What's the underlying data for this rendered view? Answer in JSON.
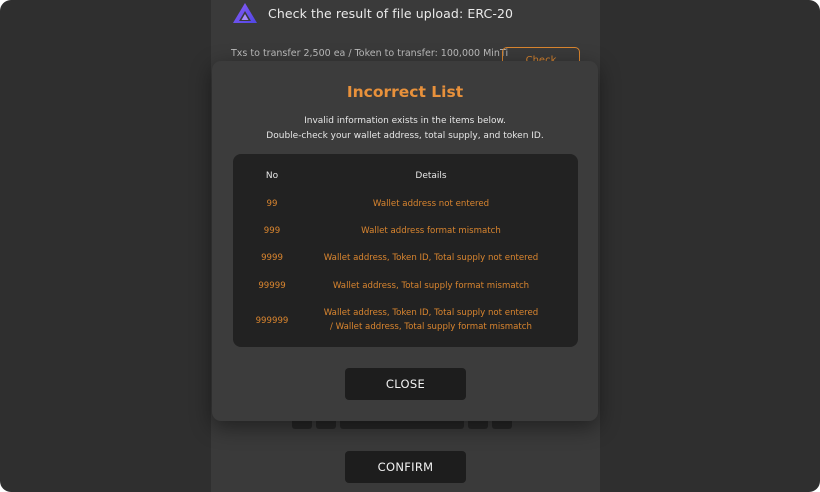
{
  "background": {
    "header_title": "Check the result of file upload: ERC-20",
    "logo_icon": "triangle-logo-icon",
    "tx_info": "Txs to transfer 2,500 ea / Token to transfer: 100,000 MinTi",
    "check_button_label": "Check",
    "confirm_label": "CONFIRM"
  },
  "modal": {
    "title": "Incorrect List",
    "description_line1": "Invalid information exists in the items below.",
    "description_line2": "Double-check your wallet address, total supply, and token ID.",
    "columns": {
      "no": "No",
      "details": "Details"
    },
    "rows": [
      {
        "no": "99",
        "details": [
          "Wallet address not entered"
        ]
      },
      {
        "no": "999",
        "details": [
          "Wallet address format mismatch"
        ]
      },
      {
        "no": "9999",
        "details": [
          "Wallet address, Token ID, Total supply not entered"
        ]
      },
      {
        "no": "99999",
        "details": [
          "Wallet address, Total supply format mismatch"
        ]
      },
      {
        "no": "999999",
        "details": [
          "Wallet address, Token ID, Total supply not entered",
          "/ Wallet address, Total supply format mismatch"
        ]
      }
    ],
    "close_label": "CLOSE"
  },
  "colors": {
    "accent_orange": "#e8913b",
    "modal_bg": "#3c3c3c",
    "list_bg": "#222222",
    "page_bg": "#2f2f2f"
  }
}
